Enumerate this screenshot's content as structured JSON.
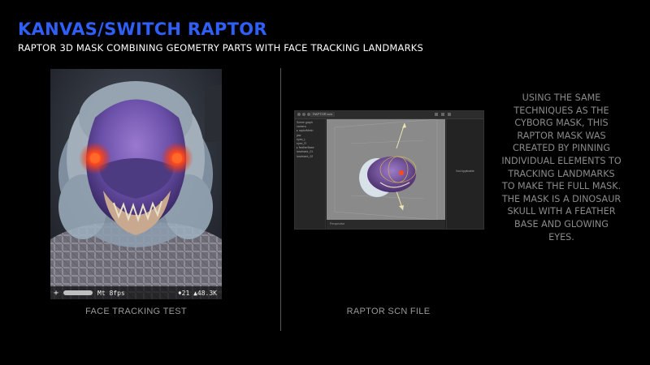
{
  "page": {
    "title": "KANVAS/SWITCH RAPTOR",
    "subtitle": "RAPTOR 3D MASK COMBINING GEOMETRY PARTS WITH FACE TRACKING LANDMARKS",
    "description": "USING THE SAME TECHNIQUES AS THE CYBORG MASK, THIS RAPTOR MASK WAS CREATED BY PINNING INDIVIDUAL ELEMENTS TO TRACKING LANDMARKS TO MAKE THE FULL MASK. THE MASK IS A DINOSAUR SKULL WITH A FEATHER BASE AND GLOWING EYES.",
    "accent_color": "#2f5ff6"
  },
  "face_preview": {
    "caption": "FACE TRACKING TEST",
    "overlay": {
      "plus": "+",
      "fps": "Mt 8fps",
      "stats": "♦21 ▲48.3K"
    }
  },
  "scene_file": {
    "caption": "RAPTOR SCN FILE",
    "tab_name": "RAPTOR.scn",
    "sidebar_items": [
      "Scene graph",
      "camera",
      "▸ raptorMesh",
      "  jaw",
      "  eyes_L",
      "  eyes_R",
      "▸ featherBase",
      "  landmark_01",
      "  landmark_02"
    ],
    "inspector_text": "Not Applicable",
    "status_text": "Perspective"
  }
}
